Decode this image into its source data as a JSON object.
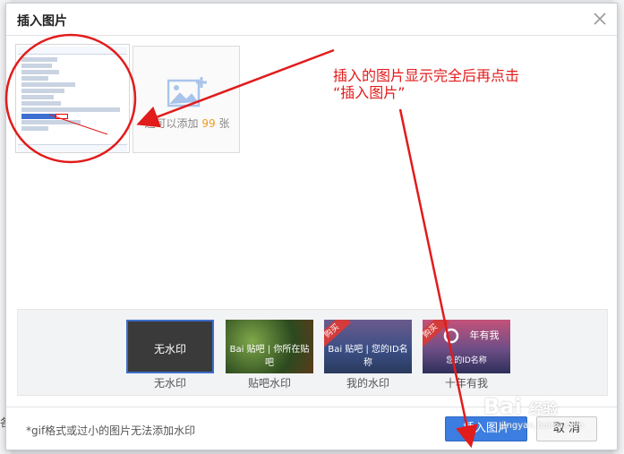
{
  "dialog": {
    "title": "插入图片"
  },
  "upload": {
    "add_text_prefix": "还可以添加",
    "add_count": "99",
    "add_text_suffix": "张"
  },
  "watermarks": [
    {
      "label": "无水印",
      "tile_text": "无水印",
      "selected": true
    },
    {
      "label": "贴吧水印",
      "tile_text": "Bai 贴吧 | 你所在贴吧"
    },
    {
      "label": "我的水印",
      "tile_text": "Bai 贴吧 | 您的ID名称",
      "badge": "购买"
    },
    {
      "label": "十年有我",
      "tile_text": "年有我",
      "tile_text_sub": "您的ID名称",
      "badge": "购买"
    }
  ],
  "footer": {
    "note": "*gif格式或过小的图片无法添加水印",
    "insert_button": "插入图片",
    "cancel_button": "取 消"
  },
  "annotation": {
    "line1": "插入的图片显示完全后再点击",
    "line2": "“插入图片”"
  },
  "background_fragments": {
    "left_char": "各"
  },
  "watermark_logo": {
    "brand": "Bai",
    "paw": "经验",
    "site": "jingyan.baidu.com"
  },
  "colors": {
    "primary": "#3b7de0",
    "accent_orange": "#f29a1f",
    "annotation_red": "#e21b1b",
    "selected_border": "#3d6ec9"
  }
}
